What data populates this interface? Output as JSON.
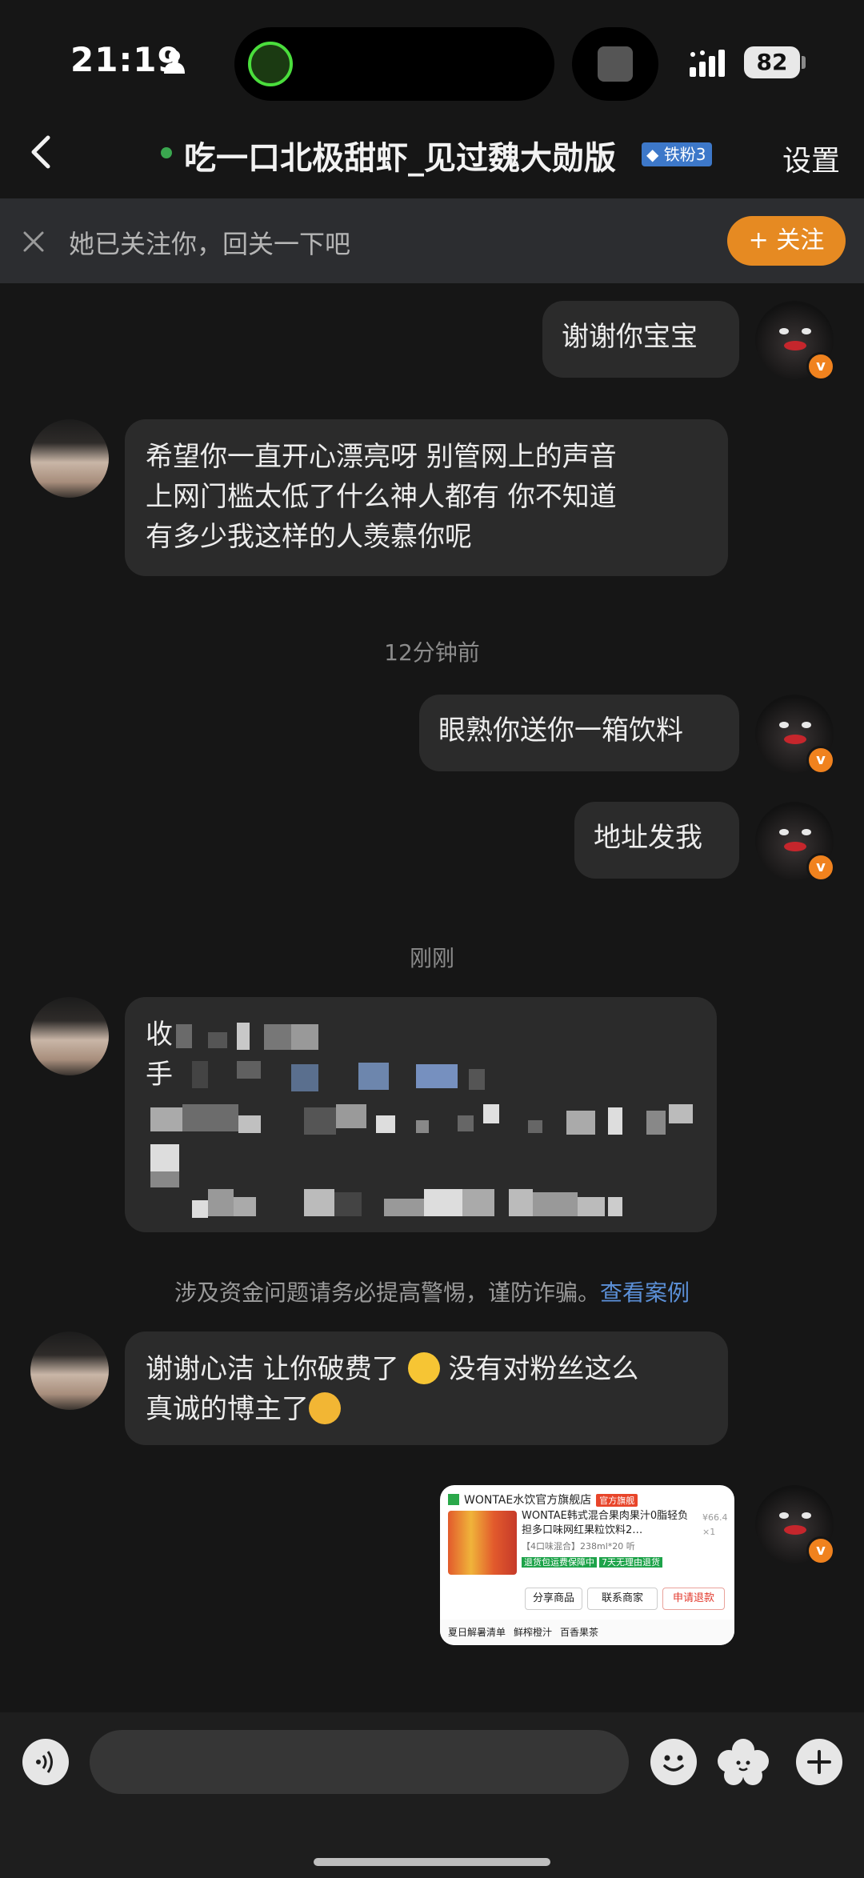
{
  "status_bar": {
    "time": "21:19",
    "battery": "82"
  },
  "header": {
    "title": "吃一口北极甜虾_见过魏大勋版",
    "fan_badge": "铁粉3",
    "settings_label": "设置"
  },
  "banner": {
    "text": "她已关注你，回关一下吧",
    "follow_label": "+ 关注"
  },
  "messages": [
    {
      "from": "me",
      "text": "谢谢你宝宝"
    },
    {
      "from": "other",
      "lines": [
        "希望你一直开心漂亮呀 别管网上的声音",
        "上网门槛太低了什么神人都有 你不知道",
        "有多少我这样的人羡慕你呢"
      ]
    },
    {
      "from": "me",
      "text": "眼熟你送你一箱饮料"
    },
    {
      "from": "me",
      "text": "地址发我"
    },
    {
      "from": "other",
      "line1_prefix": "收",
      "line2_prefix": "手"
    },
    {
      "from": "other",
      "line1": "谢谢心洁 让你破费了",
      "line1_tail": "没有对粉丝这么",
      "line2": "真诚的博主了"
    }
  ],
  "timestamps": {
    "t1": "12分钟前",
    "t2": "刚刚"
  },
  "warning": {
    "text": "涉及资金问题请务必提高警惕，谨防诈骗。",
    "link": "查看案例"
  },
  "product_card": {
    "shop": "WONTAE水饮官方旗舰店",
    "official": "官方旗舰",
    "name": "WONTAE韩式混合果肉果汁0脂轻负担多口味网红果粒饮料2…",
    "meta": "【4口味混合】238ml*20 听",
    "price": "¥66.4",
    "qty": "×1",
    "tag1": "退货包运费保障中",
    "tag2": "7天无理由退货",
    "buttons": [
      "分享商品",
      "联系商家",
      "申请退款"
    ],
    "bottom_items": [
      "夏日解暑清单",
      "鲜榨橙汁",
      "百香果茶"
    ]
  },
  "input": {
    "placeholder": ""
  },
  "colors": {
    "accent": "#e68a22",
    "online": "#3aa74f",
    "link": "#5b8fd6",
    "bubble": "#2b2b2b",
    "background": "#161616"
  }
}
